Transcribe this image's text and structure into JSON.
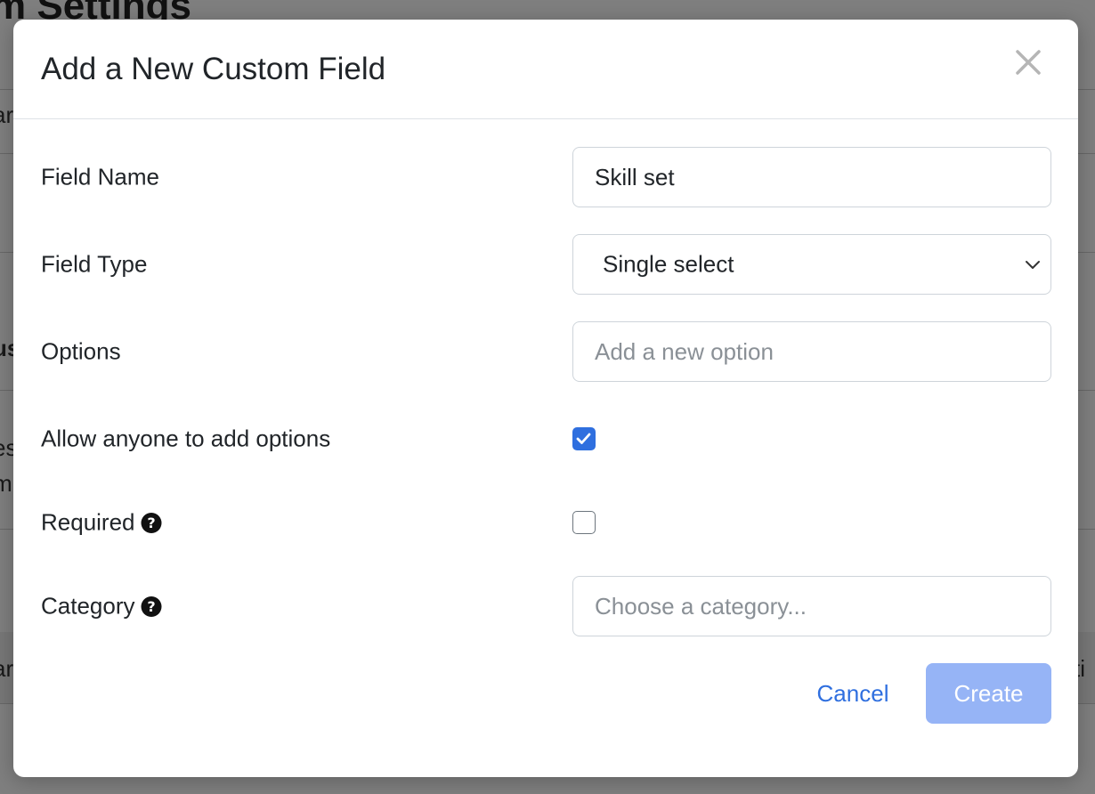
{
  "background": {
    "page_title_fragment": "m Settings",
    "fragments": [
      "ar",
      "us",
      "es",
      "m",
      "ar",
      "ti"
    ]
  },
  "modal": {
    "title": "Add a New Custom Field",
    "close_icon": "close-icon"
  },
  "form": {
    "field_name": {
      "label": "Field Name",
      "value": "Skill set"
    },
    "field_type": {
      "label": "Field Type",
      "selected": "Single select",
      "chevron_icon": "chevron-down-icon"
    },
    "options": {
      "label": "Options",
      "placeholder": "Add a new option"
    },
    "allow_anyone": {
      "label": "Allow anyone to add options",
      "checked": true
    },
    "required": {
      "label": "Required",
      "help_icon": "question-circle-icon",
      "checked": false
    },
    "category": {
      "label": "Category",
      "help_icon": "question-circle-icon",
      "placeholder": "Choose a category..."
    }
  },
  "footer": {
    "cancel_label": "Cancel",
    "create_label": "Create"
  },
  "colors": {
    "accent": "#2f6fdf",
    "create_button_disabled": "#96b4f6",
    "overlay": "rgba(0,0,0,0.5)"
  }
}
